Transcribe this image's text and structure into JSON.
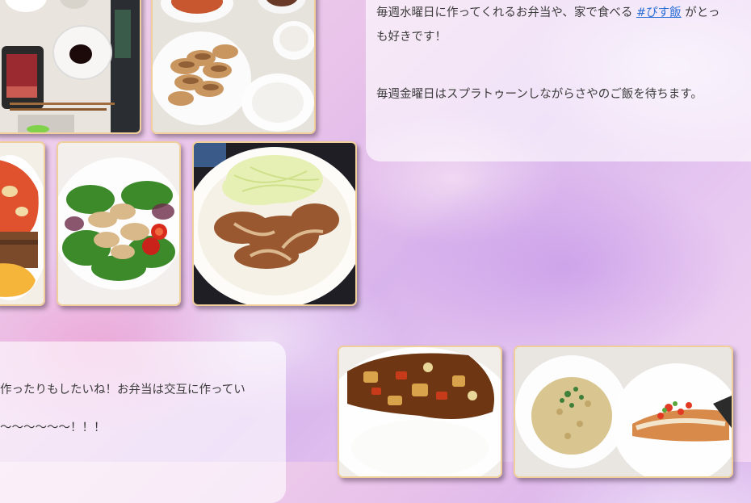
{
  "post_top": {
    "line1_text": "毎週水曜日に作ってくれるお弁当や、家で食べる",
    "hashtag": "#ぴす飯",
    "line1_suffix": "がとっ",
    "line2": "も好きです！",
    "line3": "毎週金曜日はスプラトゥーンしながらさやのご飯を待ちます。"
  },
  "post_bottom": {
    "line1": "作ったりもしたいね！お弁当は交互に作ってい",
    "line2": "〜〜〜〜〜〜！！！"
  },
  "photos": [
    {
      "name": "photo-bento-sashimi"
    },
    {
      "name": "photo-gyoza"
    },
    {
      "name": "photo-omurice"
    },
    {
      "name": "photo-chicken-salad"
    },
    {
      "name": "photo-ginger-pork"
    },
    {
      "name": "photo-curry-rice"
    },
    {
      "name": "photo-mixed-rice-fish"
    }
  ],
  "colors": {
    "link": "#2b6fd6",
    "photo_border": "#f0cf9a"
  }
}
